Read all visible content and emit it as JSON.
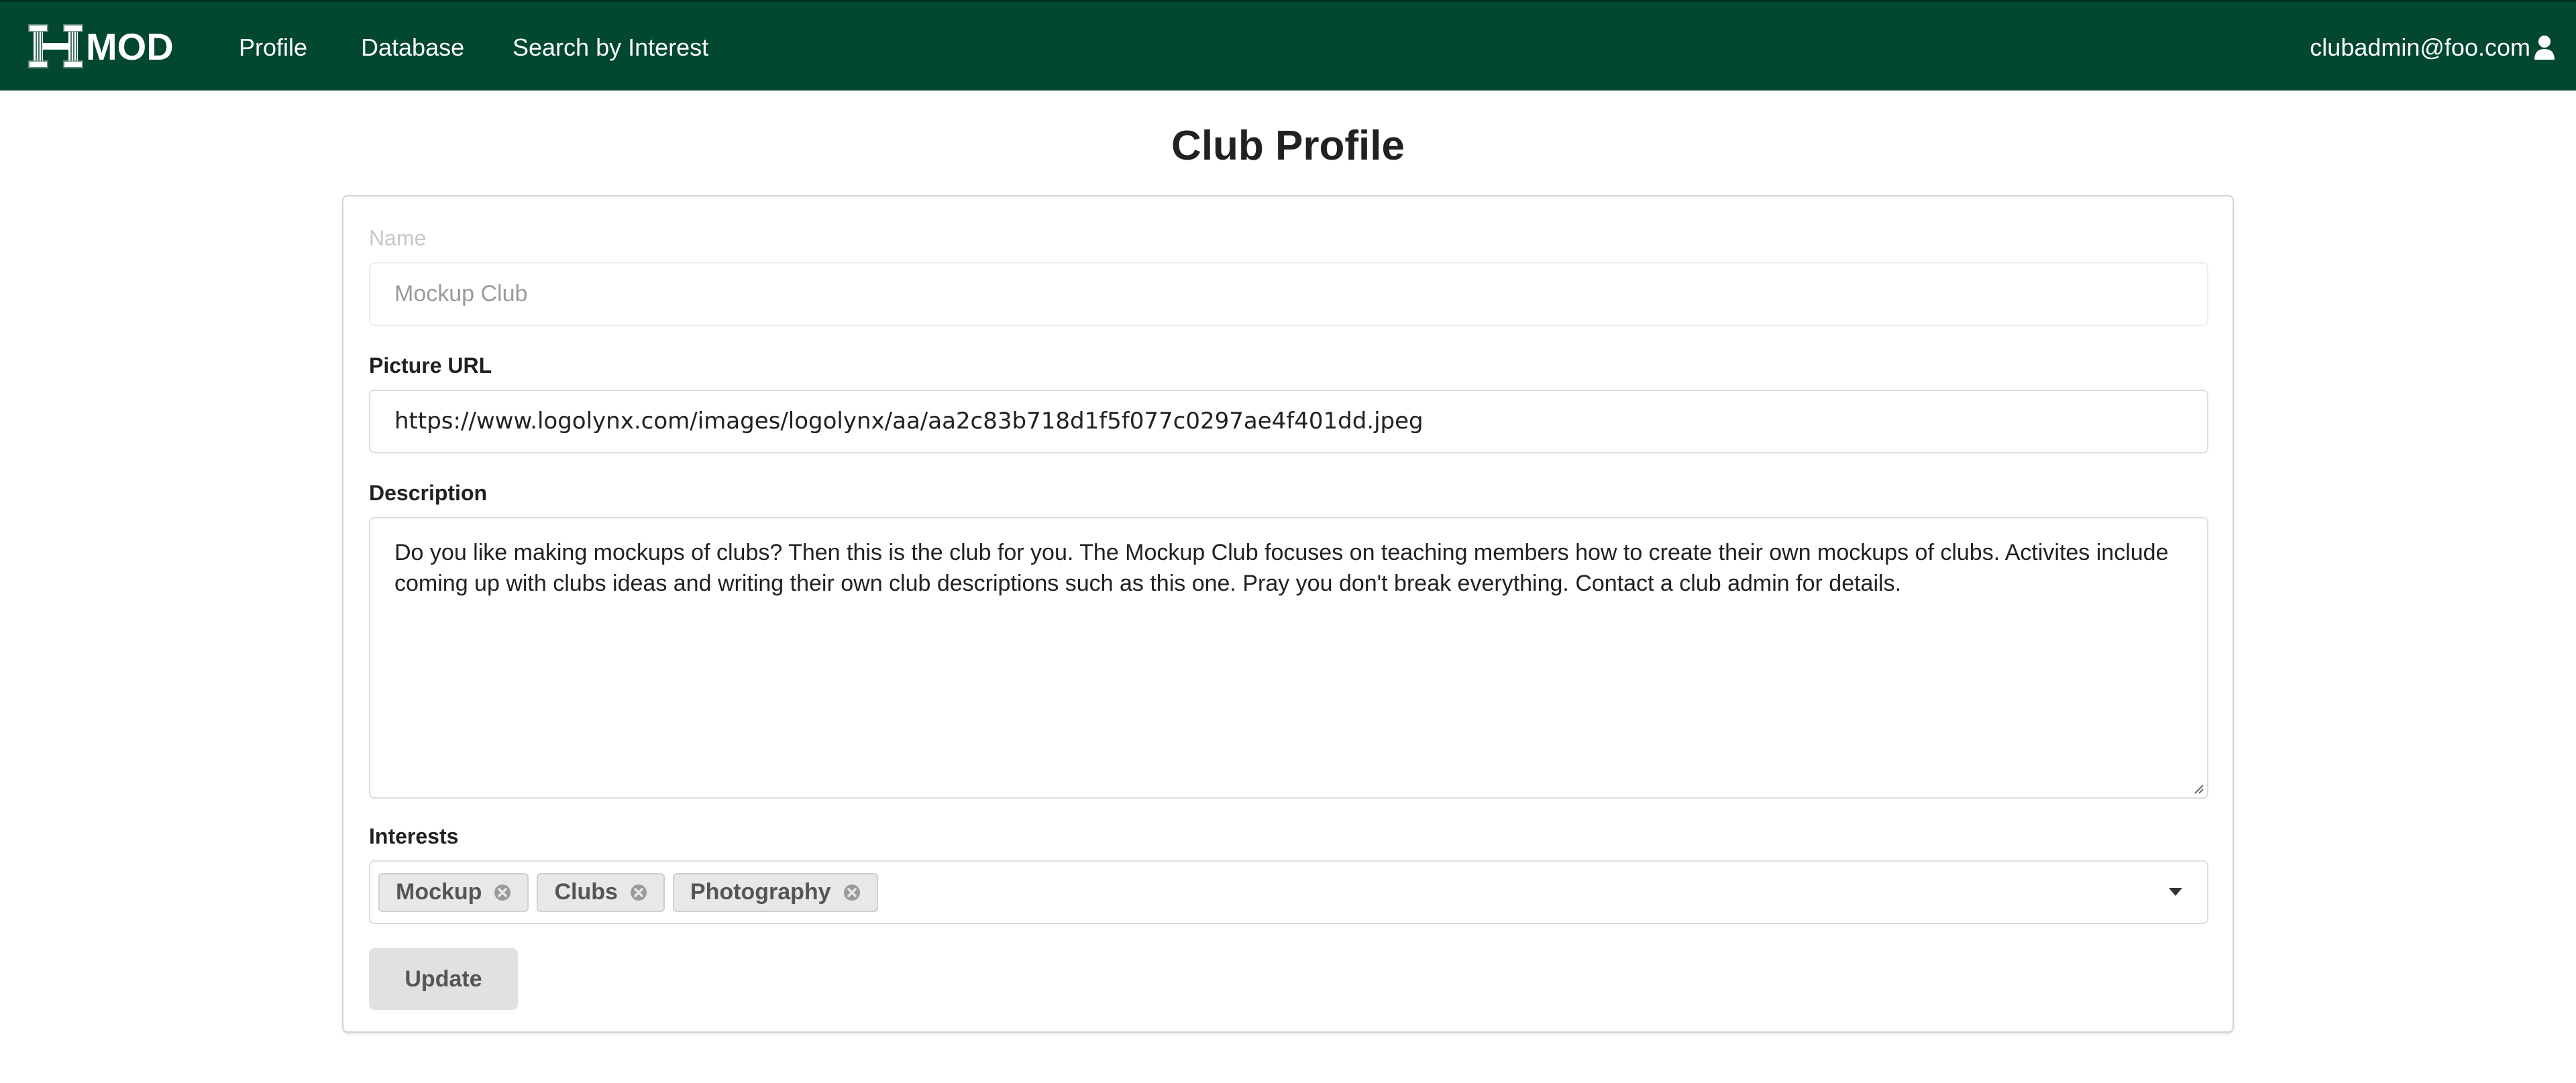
{
  "nav": {
    "brand": "MOD",
    "links": [
      "Profile",
      "Database",
      "Search by Interest"
    ],
    "user_email": "clubadmin@foo.com"
  },
  "page": {
    "title": "Club Profile"
  },
  "form": {
    "name_label": "Name",
    "name_value": "Mockup Club",
    "picture_label": "Picture URL",
    "picture_value": "https://www.logolynx.com/images/logolynx/aa/aa2c83b718d1f5f077c0297ae4f401dd.jpeg",
    "description_label": "Description",
    "description_value": "Do you like making mockups of clubs? Then this is the club for you. The Mockup Club focuses on teaching members how to create their own mockups of clubs. Activites include coming up with clubs ideas and writing their own club descriptions such as this one. Pray you don't break everything. Contact a club admin for details.",
    "interests_label": "Interests",
    "interests": [
      "Mockup",
      "Clubs",
      "Photography"
    ],
    "update_label": "Update"
  },
  "colors": {
    "navbar": "#024731",
    "button": "#e0e1e2"
  },
  "icons": {
    "brand": "hawaii-h-logo-icon",
    "user": "user-icon",
    "chip_remove": "close-icon",
    "dropdown": "caret-down-icon"
  }
}
